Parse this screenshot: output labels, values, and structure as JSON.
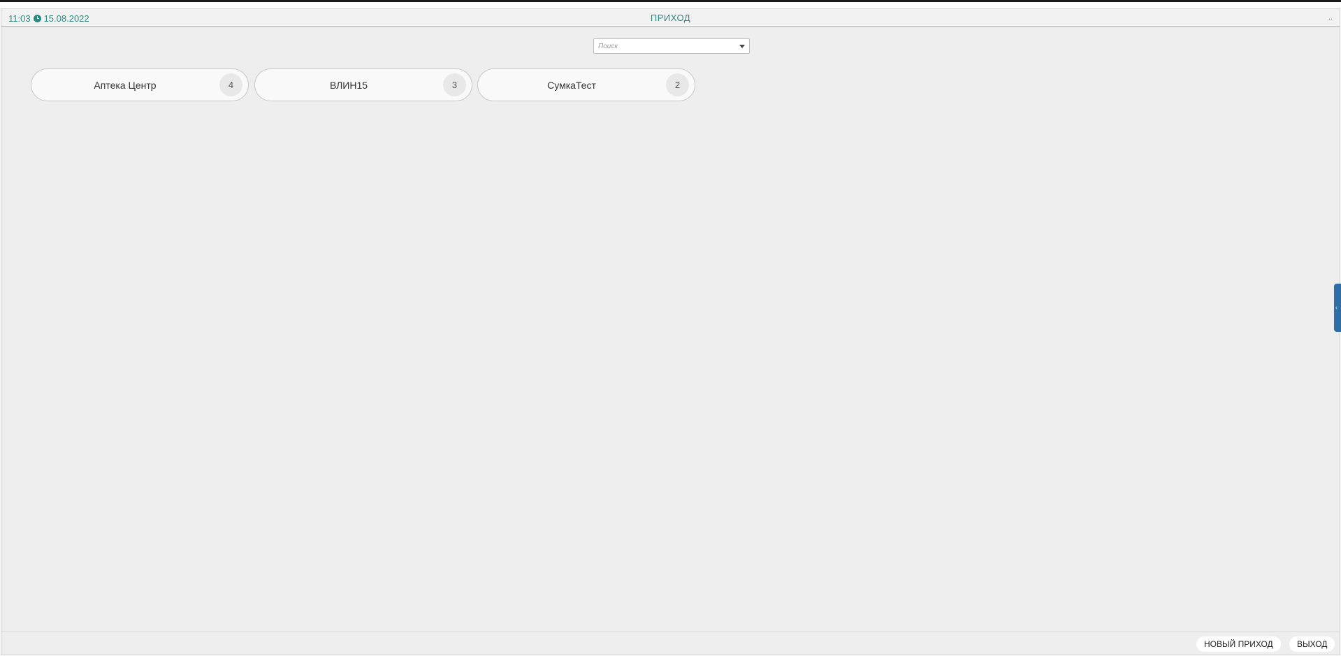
{
  "header": {
    "time": "11:03",
    "date": "15.08.2022",
    "title": "ПРИХОД",
    "menu": ".."
  },
  "search": {
    "placeholder": "Поиск",
    "value": ""
  },
  "cards": [
    {
      "label": "Аптека Центр",
      "count": "4"
    },
    {
      "label": "ВЛИН15",
      "count": "3"
    },
    {
      "label": "СумкаТест",
      "count": "2"
    }
  ],
  "footer": {
    "new_label": "НОВЫЙ ПРИХОД",
    "exit_label": "ВЫХОД"
  },
  "colors": {
    "accent": "#2a8a80",
    "panel_handle": "#2f6ea5",
    "background": "#eeeeee"
  },
  "icons": {
    "clock": "clock-icon",
    "dropdown": "chevron-down-icon",
    "side_panel": "collapse-panel-icon"
  }
}
